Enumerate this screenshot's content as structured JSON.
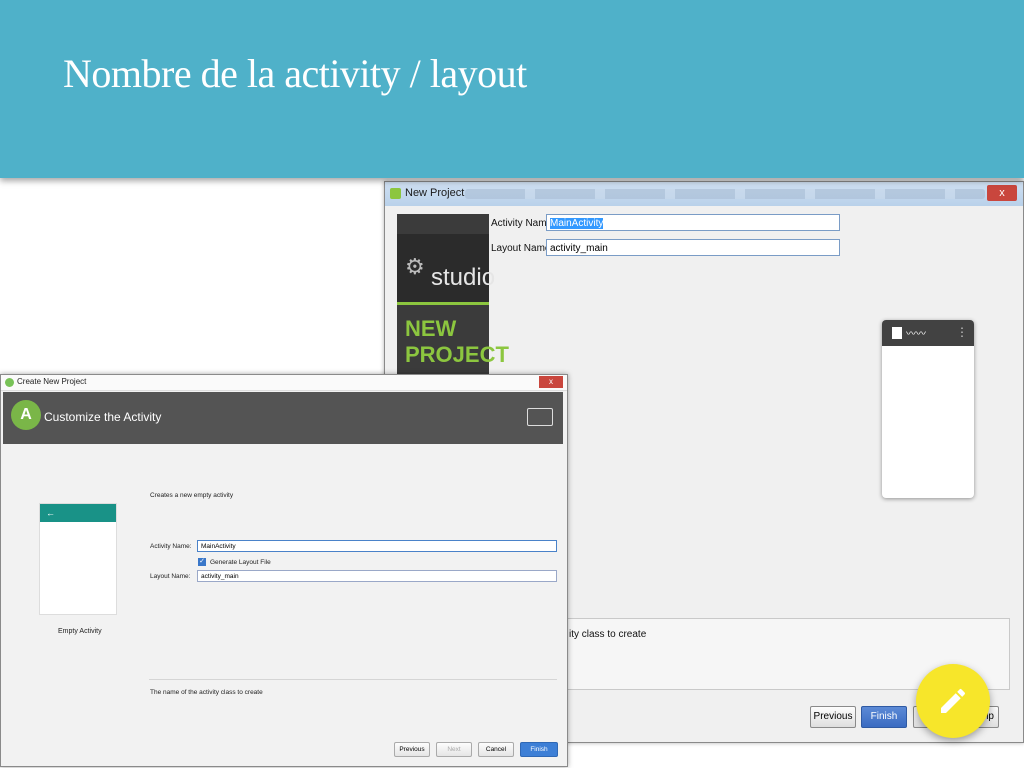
{
  "slide": {
    "title": "Nombre de la activity / layout"
  },
  "old_window": {
    "title": "New Project",
    "close": "x",
    "brand": {
      "studio_text": "studio",
      "new_project_line1": "NEW",
      "new_project_line2": "PROJECT"
    },
    "activity_name_label": "Activity Name",
    "activity_name_value": "MainActivity",
    "layout_name_label": "Layout Name",
    "layout_name_value": "activity_main",
    "description": "ity class to create",
    "buttons": {
      "previous": "Previous",
      "finish": "Finish",
      "help": "lp"
    }
  },
  "new_window": {
    "title": "Create New Project",
    "close": "x",
    "header_title": "Customize the Activity",
    "preview_caption": "Empty Activity",
    "intro": "Creates a new empty activity",
    "activity_name_label": "Activity Name:",
    "activity_name_value": "MainActivity",
    "generate_layout_label": "Generate Layout File",
    "layout_name_label": "Layout Name:",
    "layout_name_value": "activity_main",
    "description": "The name of the activity class to create",
    "buttons": {
      "previous": "Previous",
      "next": "Next",
      "cancel": "Cancel",
      "finish": "Finish"
    }
  },
  "colors": {
    "banner": "#4fb1c9",
    "fab": "#f7e62a",
    "android_green": "#8cc63f",
    "teal": "#199287"
  },
  "icons": {
    "fab": "pencil-icon"
  }
}
